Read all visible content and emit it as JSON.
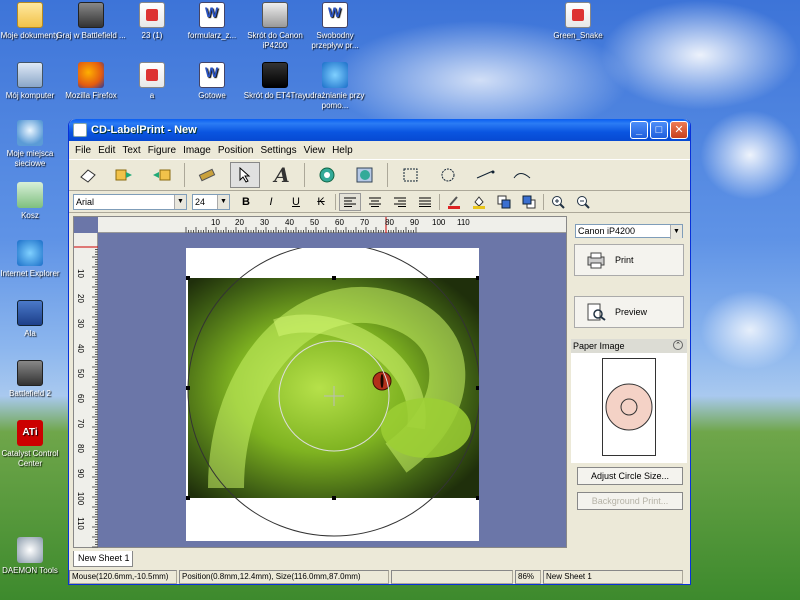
{
  "desktop": {
    "icons": [
      {
        "label": "Moje dokumenty",
        "icon": "folder-documents-icon"
      },
      {
        "label": "Graj w Battlefield ...",
        "icon": "battlefield-icon"
      },
      {
        "label": "23 (1)",
        "icon": "document-icon"
      },
      {
        "label": "formularz_z...",
        "icon": "word-document-icon"
      },
      {
        "label": "Skrót do Canon iP4200",
        "icon": "printer-shortcut-icon"
      },
      {
        "label": "Swobodny przepływ pr...",
        "icon": "word-document-icon"
      },
      {
        "label": "Green_Snake",
        "icon": "image-document-icon"
      },
      {
        "label": "Mój komputer",
        "icon": "computer-icon"
      },
      {
        "label": "Mozilla Firefox",
        "icon": "firefox-icon"
      },
      {
        "label": "a",
        "icon": "document-icon"
      },
      {
        "label": "Gotowe",
        "icon": "word-document-icon"
      },
      {
        "label": "Skrót do ET4Tray",
        "icon": "et4tray-icon"
      },
      {
        "label": "udrażnianie przy pomo...",
        "icon": "ie-document-icon"
      },
      {
        "label": "Moje miejsca sieciowe",
        "icon": "network-places-icon"
      },
      {
        "label": "Kosz",
        "icon": "recycle-bin-icon"
      },
      {
        "label": "Internet Explorer",
        "icon": "internet-explorer-icon"
      },
      {
        "label": "Ala",
        "icon": "book-icon"
      },
      {
        "label": "Battlefield 2",
        "icon": "battlefield-icon"
      },
      {
        "label": "Catalyst Control Center",
        "icon": "ati-icon"
      },
      {
        "label": "DAEMON Tools",
        "icon": "daemon-tools-icon"
      }
    ],
    "ati_logo_text": "ATi"
  },
  "window": {
    "title": "CD-LabelPrint - New",
    "controls": {
      "minimize": "_",
      "maximize": "□",
      "close": "✕"
    }
  },
  "menu": [
    "File",
    "Edit",
    "Text",
    "Figure",
    "Image",
    "Position",
    "Settings",
    "View",
    "Help"
  ],
  "format_toolbar": {
    "font": "Arial",
    "size": "24",
    "bold": "B",
    "italic": "I",
    "underline": "U",
    "strike": "K"
  },
  "rulers": {
    "horizontal": [
      "10",
      "20",
      "30",
      "40",
      "50",
      "60",
      "70",
      "80",
      "90",
      "100",
      "110"
    ],
    "vertical": [
      "10",
      "20",
      "30",
      "40",
      "50",
      "60",
      "70",
      "80",
      "90",
      "100",
      "110"
    ]
  },
  "sheet_tab": "New Sheet 1",
  "status_bar": {
    "mouse": "Mouse(120.6mm,-10.5mm)",
    "position": "Position(0.8mm,12.4mm), Size(116.0mm,87.0mm)",
    "zoom": "86%",
    "sheet": "New Sheet 1"
  },
  "right_panel": {
    "printer": "Canon iP4200",
    "print_label": "Print",
    "preview_label": "Preview",
    "paper_image_label": "Paper Image",
    "adjust_circle_label": "Adjust Circle Size...",
    "background_print_label": "Background Print..."
  },
  "colors": {
    "titlebar": "#0a55e0",
    "workspace": "#6b76a8",
    "disc_fill": "#f4d2c6",
    "ruler_marker": "#cc0000"
  }
}
